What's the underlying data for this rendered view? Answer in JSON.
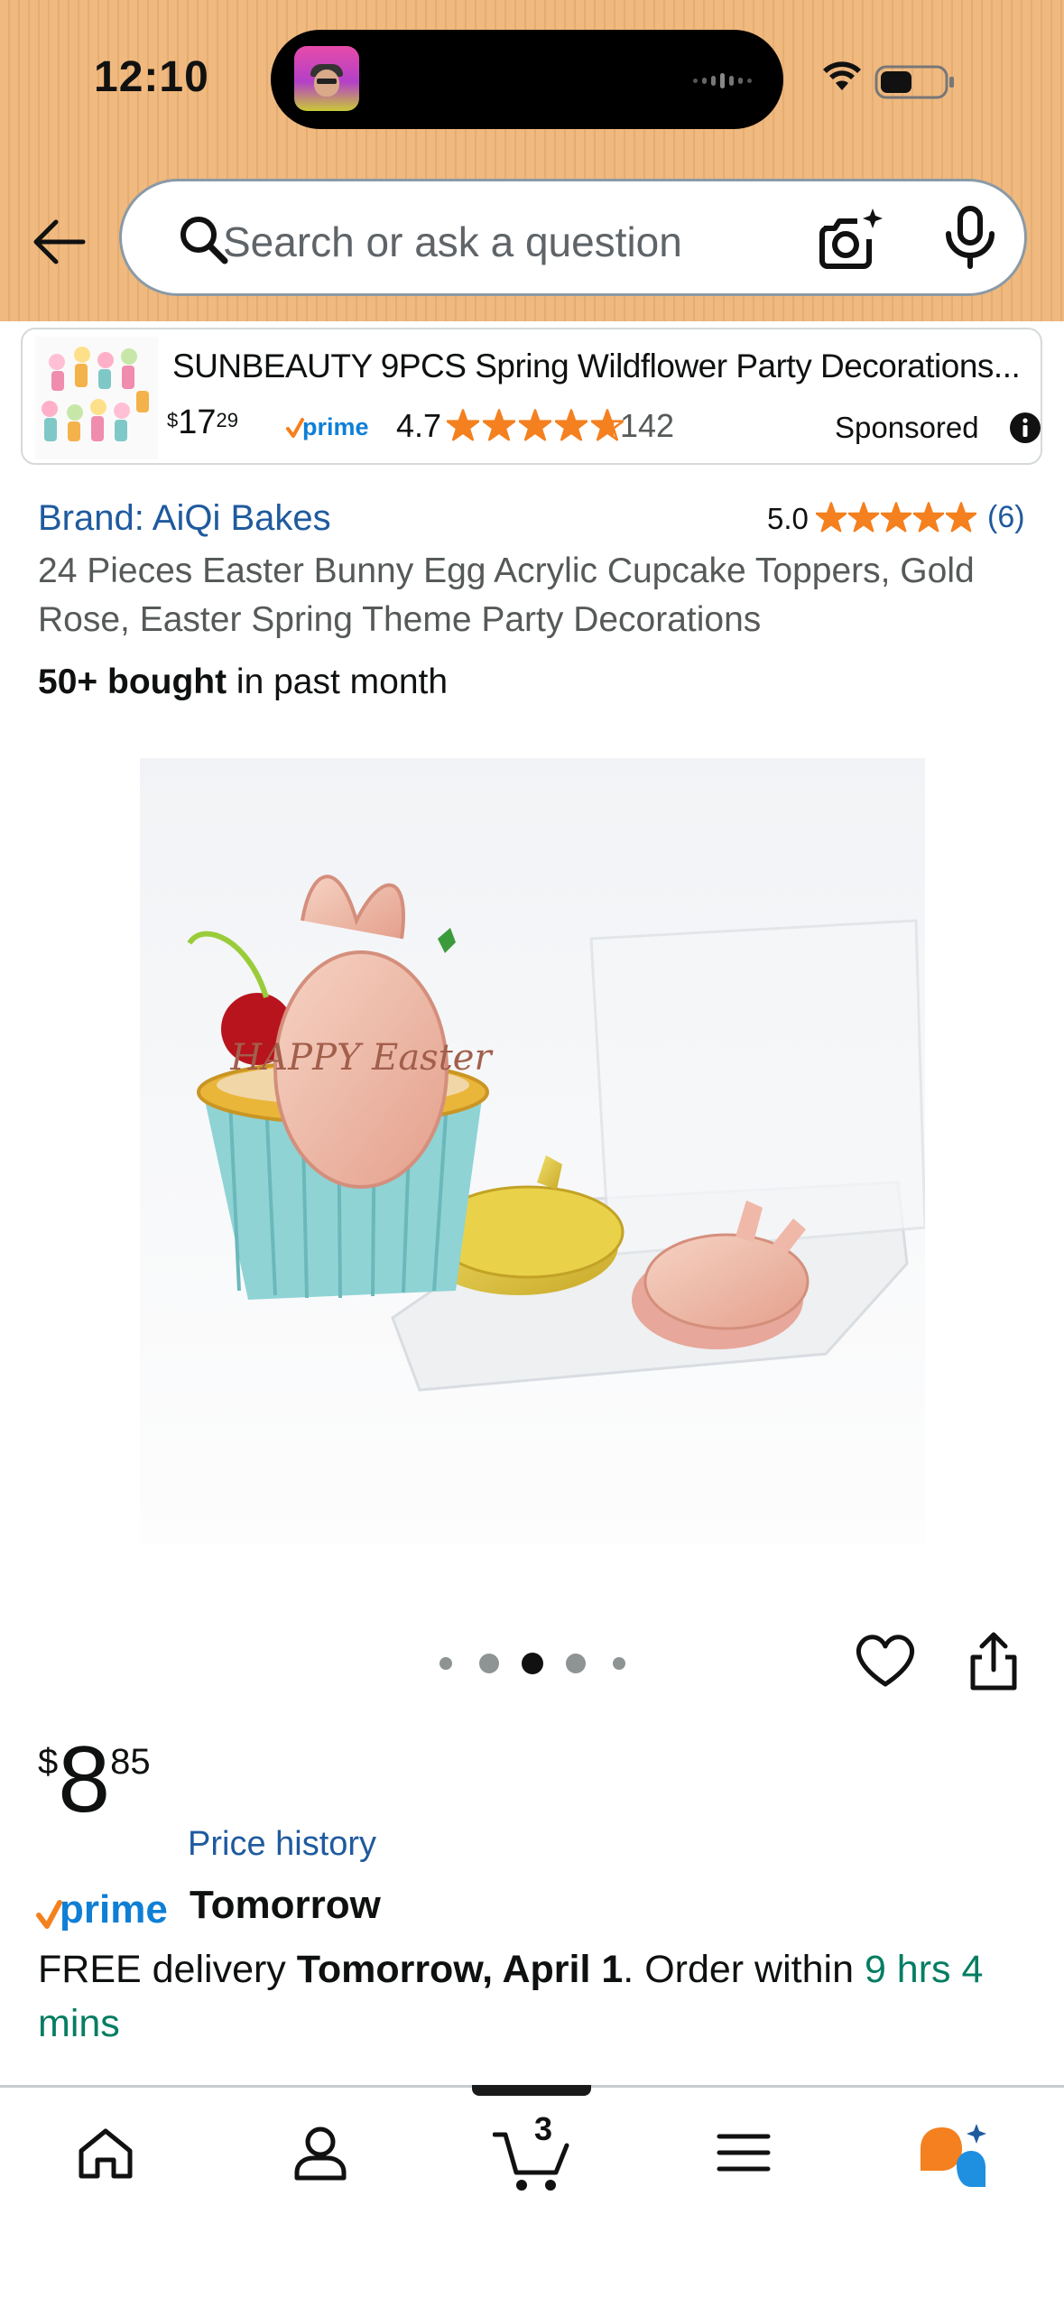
{
  "status_bar": {
    "time": "12:10"
  },
  "search": {
    "placeholder": "Search or ask a question"
  },
  "sponsored_ad": {
    "title": "SUNBEAUTY 9PCS Spring Wildflower Party Decorations...",
    "price_symbol": "$",
    "price_whole": "17",
    "price_fraction": "29",
    "rating": "4.7",
    "rating_stars": 4.7,
    "review_count": "142",
    "sponsored_label": "Sponsored"
  },
  "product": {
    "brand_link": "Brand: AiQi Bakes",
    "rating": "5.0",
    "rating_stars": 5,
    "review_count": "(6)",
    "title": "24 Pieces Easter Bunny Egg Acrylic Cupcake Toppers, Gold Rose, Easter Spring Theme Party Decorations",
    "bought_strong": "50+ bought",
    "bought_rest": " in past month",
    "image_text": "HAPPY Easter",
    "image_count": 5,
    "image_index": 3,
    "price_symbol": "$",
    "price_whole": "8",
    "price_fraction": "85",
    "price_history_link": "Price history",
    "prime_label": "prime",
    "prime_day": "Tomorrow",
    "delivery_prefix": "FREE delivery ",
    "delivery_date": "Tomorrow, April 1",
    "delivery_middle": ". Order within ",
    "delivery_countdown": "9 hrs 4 mins"
  },
  "tab_bar": {
    "items": [
      "home-icon",
      "account-icon",
      "cart-icon",
      "menu-icon",
      "rufus-icon"
    ],
    "cart_count": "3"
  },
  "colors": {
    "link": "#1f5a9e",
    "star": "#f4801f",
    "prime_blue": "#0f7fd5",
    "countdown_green": "#067d62",
    "header_bg": "#efb97f"
  }
}
